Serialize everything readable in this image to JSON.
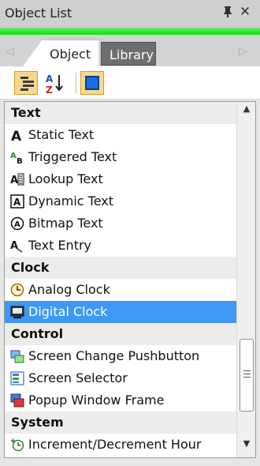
{
  "window": {
    "title": "Object List",
    "pin_glyph": "⬢",
    "close_glyph": "✕"
  },
  "tabs": {
    "left_arrow": "◁",
    "right_arrow": "▷",
    "items": [
      {
        "label": "Object",
        "active": true
      },
      {
        "label": "Library",
        "active": false
      }
    ]
  },
  "toolbar": {
    "buttons": [
      {
        "name": "categorized-view-button",
        "active": true
      },
      {
        "name": "alphabetical-sort-button",
        "active": false
      },
      {
        "name": "display-mode-button",
        "active": true
      }
    ]
  },
  "list": {
    "categories": [
      {
        "label": "Text",
        "items": [
          {
            "label": "Static Text",
            "icon": "static-text-icon"
          },
          {
            "label": "Triggered Text",
            "icon": "triggered-text-icon"
          },
          {
            "label": "Lookup Text",
            "icon": "lookup-text-icon"
          },
          {
            "label": "Dynamic Text",
            "icon": "dynamic-text-icon"
          },
          {
            "label": "Bitmap Text",
            "icon": "bitmap-text-icon"
          },
          {
            "label": "Text Entry",
            "icon": "text-entry-icon"
          }
        ]
      },
      {
        "label": "Clock",
        "items": [
          {
            "label": "Analog Clock",
            "icon": "analog-clock-icon"
          },
          {
            "label": "Digital Clock",
            "icon": "digital-clock-icon",
            "selected": true
          }
        ]
      },
      {
        "label": "Control",
        "items": [
          {
            "label": "Screen Change Pushbutton",
            "icon": "screen-change-icon"
          },
          {
            "label": "Screen Selector",
            "icon": "screen-selector-icon"
          },
          {
            "label": "Popup Window Frame",
            "icon": "popup-window-icon"
          }
        ]
      },
      {
        "label": "System",
        "items": [
          {
            "label": "Increment/Decrement Hour",
            "icon": "increment-hour-icon"
          }
        ]
      }
    ]
  },
  "scrollbar": {
    "up_glyph": "▲",
    "down_glyph": "▼"
  },
  "colors": {
    "accent_bar": "#22ee22",
    "selection": "#3f98f3",
    "library_tab": "#6e6e6e",
    "active_button": "#f7d78c"
  }
}
